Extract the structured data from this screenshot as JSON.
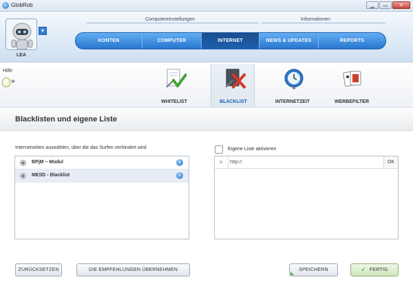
{
  "window": {
    "title": "GlobRob",
    "min_label": "▁",
    "max_label": "▭",
    "close_label": "✕"
  },
  "header": {
    "username": "LEA",
    "group_computer": "Computereinstellungen",
    "group_info": "Informationen",
    "tabs": [
      {
        "label": "KONTEN"
      },
      {
        "label": "COMPUTER"
      },
      {
        "label": "INTERNET"
      },
      {
        "label": "NEWS & UPDATES"
      },
      {
        "label": "REPORTS"
      }
    ],
    "active_tab": "INTERNET",
    "accent_color": "#2776cf"
  },
  "help": {
    "label": "Hilfe",
    "arrows": "»"
  },
  "subnav": {
    "items": [
      {
        "label": "WHITELIST",
        "icon": "whitelist-check-icon"
      },
      {
        "label": "BLACKLIST",
        "icon": "blacklist-x-icon"
      },
      {
        "label": "INTERNETZEIT",
        "icon": "clock-icon"
      },
      {
        "label": "WERBEFILTER",
        "icon": "cards-icon"
      }
    ],
    "active": "BLACKLIST"
  },
  "section": {
    "title": "Blacklisten und eigene Liste"
  },
  "left_panel": {
    "hint": "Internetseiten auswählen, über die das Surfen verhindert wird",
    "items": [
      {
        "label": "BPjM – Modul",
        "info": "i"
      },
      {
        "label": "MESD - Blacklist",
        "info": "i"
      }
    ]
  },
  "right_panel": {
    "checkbox_label": "Eigene Liste aktivieren",
    "checked": false,
    "url_value": "http://",
    "plus_label": "+",
    "ok_label": "OK"
  },
  "buttons": {
    "reset": "ZURÜCKSETZEN",
    "recommend": "DIE EMPFEHLUNGEN ÜBERNEHMEN",
    "save": "SPEICHERN",
    "done": "FERTIG",
    "done_check": "✓"
  }
}
